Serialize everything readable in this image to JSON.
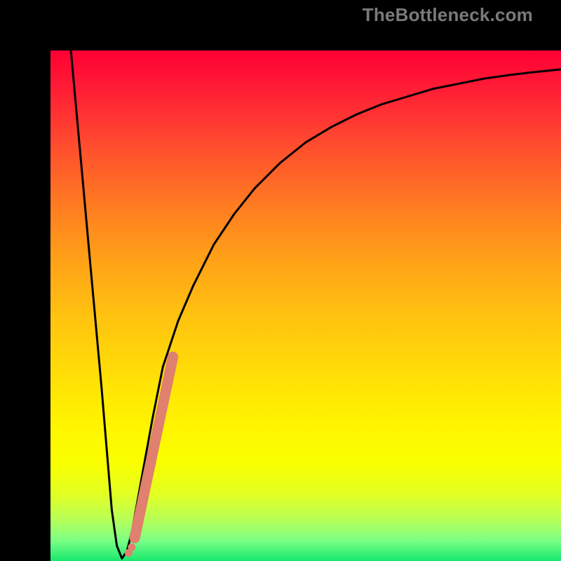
{
  "watermark": "TheBottleneck.com",
  "chart_data": {
    "type": "line",
    "title": "",
    "xlabel": "",
    "ylabel": "",
    "xlim": [
      0,
      100
    ],
    "ylim": [
      0,
      100
    ],
    "series": [
      {
        "name": "bottleneck-curve",
        "x": [
          4,
          6,
          8,
          10,
          12,
          13,
          14,
          15,
          16,
          18,
          20,
          22,
          25,
          28,
          32,
          36,
          40,
          45,
          50,
          55,
          60,
          65,
          70,
          75,
          80,
          85,
          90,
          95,
          100
        ],
        "values": [
          100,
          78,
          56,
          34,
          10,
          3,
          0.5,
          2,
          6,
          17,
          28,
          38,
          47,
          54,
          62,
          68,
          73,
          78,
          82,
          85,
          87.5,
          89.5,
          91,
          92.5,
          93.5,
          94.5,
          95.2,
          95.8,
          96.3
        ]
      }
    ],
    "highlight_segment": {
      "name": "highlighted-range",
      "color": "#e0806e",
      "x": [
        16.5,
        24
      ],
      "values": [
        4.5,
        40
      ]
    },
    "highlight_dots": {
      "name": "small-dots",
      "color": "#e0806e",
      "points": [
        {
          "x": 15.3,
          "y": 1.6
        },
        {
          "x": 15.9,
          "y": 2.7
        }
      ]
    }
  }
}
